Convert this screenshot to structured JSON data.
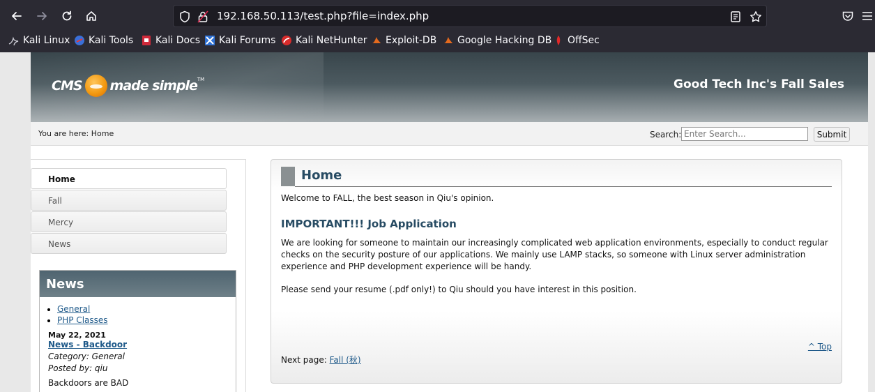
{
  "browser": {
    "url": "192.168.50.113/test.php?file=index.php",
    "bookmarks": [
      {
        "label": "Kali Linux",
        "icon": "kali-dragon-icon"
      },
      {
        "label": "Kali Tools",
        "icon": "kali-tools-icon"
      },
      {
        "label": "Kali Docs",
        "icon": "kali-docs-icon"
      },
      {
        "label": "Kali Forums",
        "icon": "kali-forums-icon"
      },
      {
        "label": "Kali NetHunter",
        "icon": "kali-nethunter-icon"
      },
      {
        "label": "Exploit-DB",
        "icon": "exploit-db-icon"
      },
      {
        "label": "Google Hacking DB",
        "icon": "ghdb-icon"
      },
      {
        "label": "OffSec",
        "icon": "offsec-icon"
      }
    ]
  },
  "header": {
    "logo_left": "CMS",
    "logo_right": "made simple",
    "logo_tm": "TM",
    "site_title": "Good Tech Inc's Fall Sales"
  },
  "crumbbar": {
    "breadcrumb": "You are here: Home",
    "search_label": "Search:",
    "search_placeholder": "Enter Search...",
    "submit_label": "Submit"
  },
  "menu": [
    {
      "label": "Home",
      "active": true
    },
    {
      "label": "Fall",
      "active": false
    },
    {
      "label": "Mercy",
      "active": false
    },
    {
      "label": "News",
      "active": false
    }
  ],
  "news": {
    "heading": "News",
    "categories": [
      "General",
      "PHP Classes"
    ],
    "date": "May 22, 2021",
    "title": "News - Backdoor",
    "category": "Category: General",
    "posted_by": "Posted by: qiu",
    "body": "Backdoors are BAD"
  },
  "content": {
    "title": "Home",
    "welcome": "Welcome to FALL, the best season in Qiu's opinion.",
    "subhead": "IMPORTANT!!! Job Application",
    "para1": "We are looking for someone to maintain our increasingly complicated web application environments, especially to conduct regular checks on the security posture of our applications. We mainly use LAMP stacks, so someone with Linux server administration experience and PHP development experience will be handy.",
    "para2": "Please send your resume (.pdf only!) to Qiu should you have interest in this position.",
    "top_link": "^ Top",
    "next_label": "Next page: ",
    "next_link": "Fall (秋)"
  },
  "colors": {
    "chrome_bg": "#2b2a33",
    "heading_blue": "#274b63",
    "link_blue": "#1f5a8a"
  }
}
